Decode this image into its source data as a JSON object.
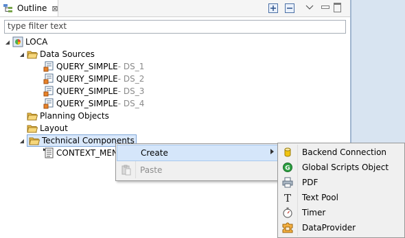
{
  "view": {
    "tab_title": "Outline",
    "tab_close_glyph": "⊠",
    "icons": [
      "outline-view-icon",
      "expand-all-icon",
      "collapse-all-icon",
      "view-menu-icon",
      "minimize-icon",
      "maximize-icon"
    ]
  },
  "filter": {
    "placeholder": "type filter text",
    "value": ""
  },
  "tree": {
    "root": {
      "label": "LOCA",
      "icon": "application-icon"
    },
    "data_sources": {
      "label": "Data Sources",
      "children": [
        {
          "name": "QUERY_SIMPLE",
          "suffix": " - DS_1"
        },
        {
          "name": "QUERY_SIMPLE",
          "suffix": " - DS_2"
        },
        {
          "name": "QUERY_SIMPLE",
          "suffix": " - DS_3"
        },
        {
          "name": "QUERY_SIMPLE",
          "suffix": " - DS_4"
        }
      ]
    },
    "planning_objects": {
      "label": "Planning Objects"
    },
    "layout": {
      "label": "Layout"
    },
    "technical_components": {
      "label": "Technical Components",
      "children": [
        {
          "name": "CONTEXT_MEN"
        }
      ]
    }
  },
  "context_menu": {
    "items": [
      {
        "label": "Create",
        "has_submenu": true,
        "highlighted": true
      },
      {
        "label": "Paste",
        "enabled": false
      }
    ]
  },
  "create_submenu": {
    "items": [
      {
        "label": "Backend Connection",
        "icon": "database-cylinder-icon"
      },
      {
        "label": "Global Scripts Object",
        "icon": "global-scripts-icon"
      },
      {
        "label": "PDF",
        "icon": "printer-icon"
      },
      {
        "label": "Text Pool",
        "icon": "text-t-icon"
      },
      {
        "label": "Timer",
        "icon": "stopwatch-icon"
      },
      {
        "label": "DataProvider",
        "icon": "dataprovider-puzzle-icon"
      }
    ]
  },
  "colors": {
    "selection_bg": "#d9e8fb",
    "menu_highlight": "#d5e6fa",
    "folder_yellow": "#f3c85a",
    "side_panel": "#d8e4f1"
  }
}
